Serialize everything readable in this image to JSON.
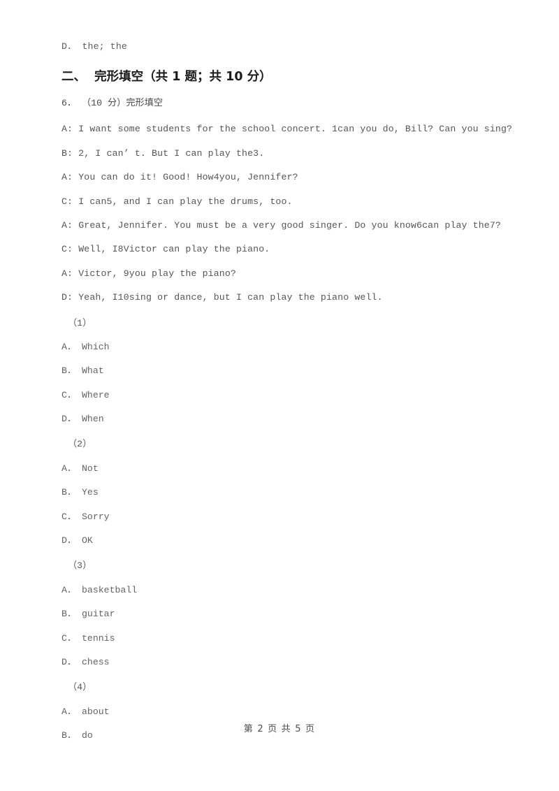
{
  "document": {
    "background_color": "#ffffff",
    "text_color": "#585858"
  },
  "carryover_option": {
    "text": "D． the; the"
  },
  "section": {
    "heading": "二、  完形填空（共 1 题；共 10 分）"
  },
  "question": {
    "number_and_points": "6． （10 分）完形填空",
    "dialogue": [
      "A: I want some students for the school concert. 1can you do, Bill? Can you sing?",
      "B: 2, I can’ t. But I can play the3.",
      "A: You can do it! Good! How4you, Jennifer?",
      "C: I can5, and I can play the drums, too.",
      "A: Great, Jennifer. You must be a very good singer. Do you know6can play the7?",
      "C: Well, I8Victor can play the piano.",
      "A: Victor, 9you play the piano?",
      "D: Yeah, I10sing or dance, but I can play the piano well."
    ],
    "blanks": [
      {
        "label": "（1）",
        "options": [
          "A． Which",
          "B． What",
          "C． Where",
          "D． When"
        ]
      },
      {
        "label": "（2）",
        "options": [
          "A． Not",
          "B． Yes",
          "C． Sorry",
          "D． OK"
        ]
      },
      {
        "label": "（3）",
        "options": [
          "A． basketball",
          "B． guitar",
          "C． tennis",
          "D． chess"
        ]
      },
      {
        "label": "（4）",
        "options": [
          "A． about",
          "B． do"
        ]
      }
    ]
  },
  "footer": {
    "page_info": "第 2 页 共 5 页"
  }
}
